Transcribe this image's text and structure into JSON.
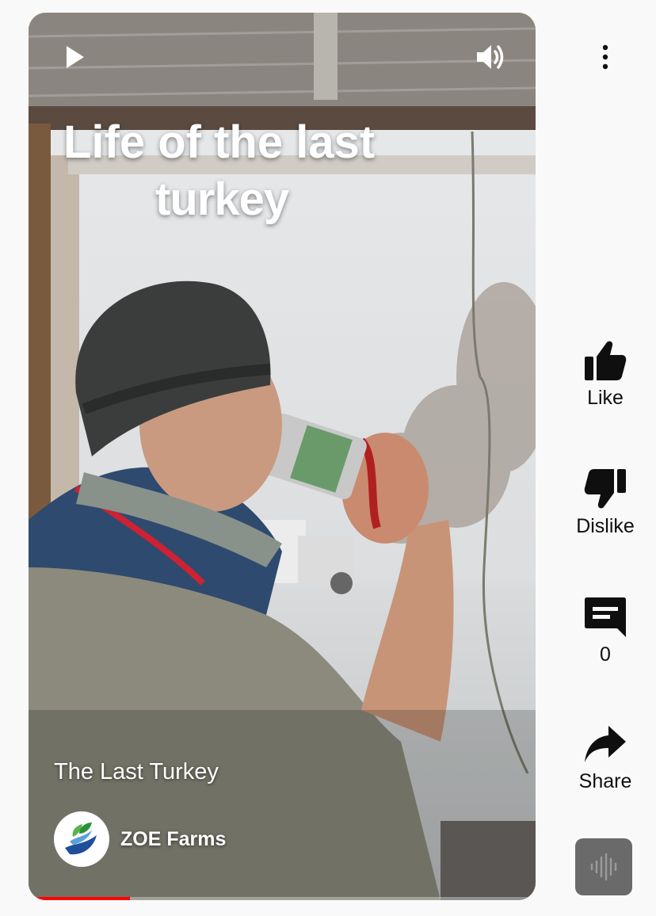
{
  "video": {
    "overlay_line1": "Life of the last",
    "overlay_line2": "turkey",
    "short_title": "The Last Turkey",
    "channel_name": "ZOE Farms",
    "progress": 0.2
  },
  "actions": {
    "like_label": "Like",
    "dislike_label": "Dislike",
    "comments_count": "0",
    "share_label": "Share"
  },
  "colors": {
    "accent": "#ff0000",
    "background": "#f9f9f9",
    "text": "#0f0f0f"
  },
  "icons": [
    "play-icon",
    "volume-icon",
    "more-vert-icon",
    "thumb-up-icon",
    "thumb-down-icon",
    "comment-icon",
    "share-icon",
    "sound-wave-icon"
  ]
}
